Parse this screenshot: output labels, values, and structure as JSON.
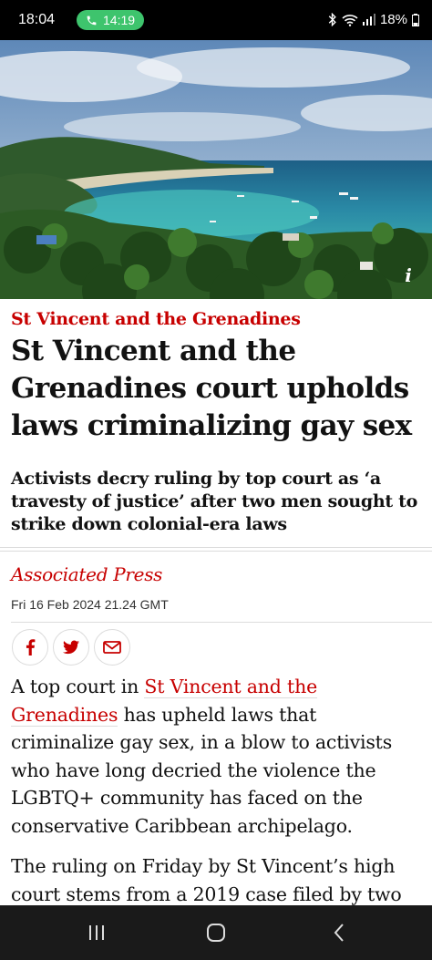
{
  "status_bar": {
    "time": "18:04",
    "call_time": "14:19",
    "battery": "18%",
    "icons": [
      "bluetooth-icon",
      "wifi-icon",
      "signal-icon",
      "battery-icon"
    ]
  },
  "hero": {
    "info_icon": "i"
  },
  "article": {
    "kicker": "St Vincent and the Grenadines",
    "headline": "St Vincent and the Grenadines court upholds laws criminalizing gay sex",
    "standfirst": "Activists decry ruling by top court as ‘a travesty of justice’ after two men sought to strike down colonial-era laws",
    "byline": "Associated Press",
    "date": "Fri 16 Feb 2024 21.24 GMT",
    "share": [
      "facebook-icon",
      "twitter-icon",
      "email-icon"
    ],
    "paragraph1": {
      "before": "A top court in ",
      "link": "St Vincent and the Grenadines",
      "after": " has upheld laws that criminalize gay sex, in a blow to activists who have long decried the violence the LGBTQ+ community has faced on the conservative Caribbean archipelago."
    },
    "paragraph2": "The ruling on Friday by St Vincent’s high court stems from a 2019 case filed by two"
  },
  "colors": {
    "accent": "#c70000",
    "text": "#121212",
    "rule": "#dcdcdc",
    "call_pill": "#3ec46d"
  }
}
